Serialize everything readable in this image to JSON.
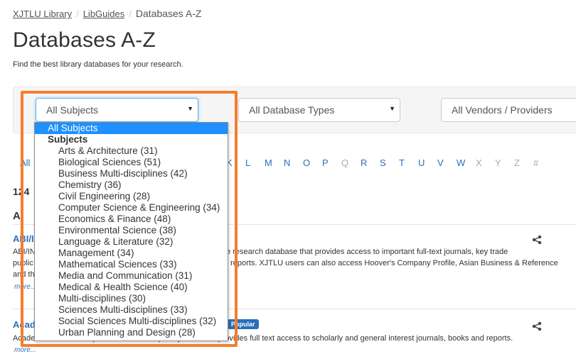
{
  "breadcrumb": {
    "home": "XJTLU Library",
    "libguides": "LibGuides",
    "current": "Databases A-Z",
    "separator": "/"
  },
  "page": {
    "title": "Databases A-Z",
    "subtitle": "Find the best library databases for your research."
  },
  "filters": {
    "subjects": "All Subjects",
    "types": "All Database Types",
    "vendors": "All Vendors / Providers",
    "caret": "▼"
  },
  "az": {
    "all": "All",
    "letters": [
      {
        "label": "K",
        "active": true
      },
      {
        "label": "L",
        "active": true
      },
      {
        "label": "M",
        "active": true
      },
      {
        "label": "N",
        "active": true
      },
      {
        "label": "O",
        "active": true
      },
      {
        "label": "P",
        "active": true
      },
      {
        "label": "Q",
        "active": false
      },
      {
        "label": "R",
        "active": true
      },
      {
        "label": "S",
        "active": true
      },
      {
        "label": "T",
        "active": true
      },
      {
        "label": "U",
        "active": true
      },
      {
        "label": "V",
        "active": true
      },
      {
        "label": "W",
        "active": true
      },
      {
        "label": "X",
        "active": false
      },
      {
        "label": "Y",
        "active": false
      },
      {
        "label": "Z",
        "active": false
      },
      {
        "label": "#",
        "active": false
      }
    ]
  },
  "results": {
    "count": "124",
    "letter": "A",
    "databases": [
      {
        "title": "ABI/I",
        "desc_line1_left": "ABI/IN",
        "desc_line1_right": "e research database that provides access to important full-text journals, key trade",
        "desc_line2_left": "public",
        "desc_line2_right": "t reports. XJTLU users can also access Hoover's Company Profile, Asian Business & Reference",
        "desc_line3_left": "and th",
        "more": "more..."
      },
      {
        "title": "Acad",
        "badge": "Popular",
        "desc_line1_left": "Academic Search Complete is a multidisciplinary database provides full text access to scholarly and general interest journals, books and reports.",
        "more": "more..."
      }
    ]
  },
  "dropdown": {
    "selected": "All Subjects",
    "group": "Subjects",
    "options": [
      "Arts & Architecture (31)",
      "Biological Sciences (51)",
      "Business Multi-disciplines (42)",
      "Chemistry (36)",
      "Civil Engineering (28)",
      "Computer Science & Engineering (34)",
      "Economics & Finance (48)",
      "Environmental Science (38)",
      "Language & Literature (32)",
      "Management (34)",
      "Mathematical Sciences (33)",
      "Media and Communication (31)",
      "Medical & Health Science (40)",
      "Multi-disciplines (30)",
      "Sciences Multi-disciplines (33)",
      "Social Sciences Multi-disciplines (32)",
      "Urban Planning and Design (28)"
    ]
  },
  "colors": {
    "link": "#2a6ebb",
    "highlight": "#f47e2b",
    "selected": "#1e90ff"
  }
}
